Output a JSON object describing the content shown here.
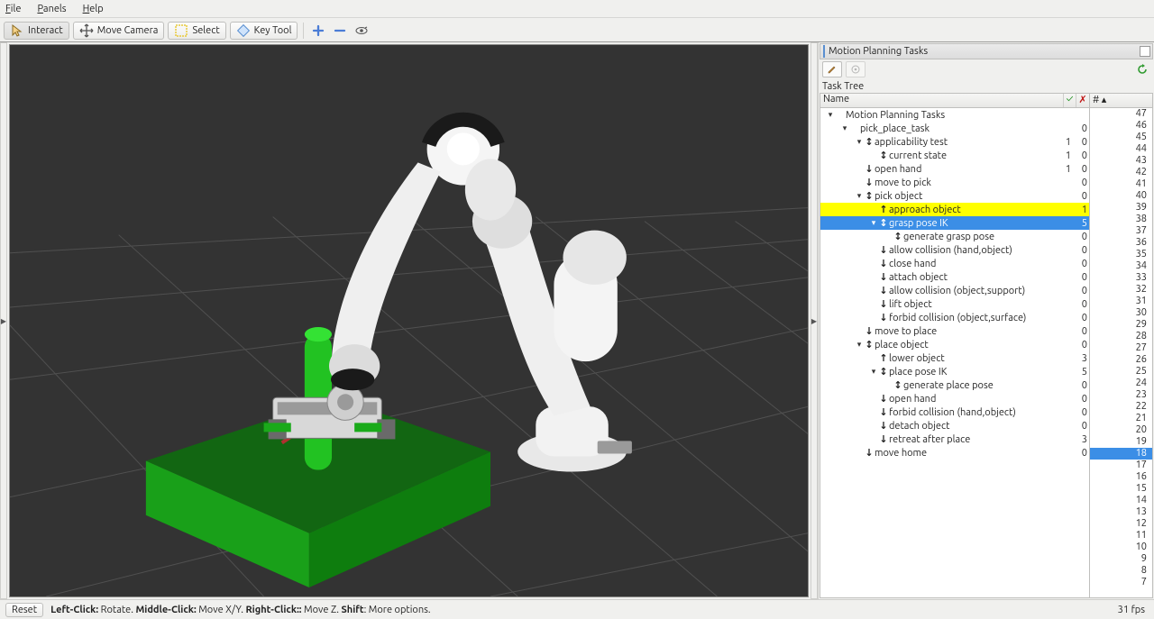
{
  "menu": {
    "file": "File",
    "panels": "Panels",
    "help": "Help"
  },
  "toolbar": {
    "interact": "Interact",
    "move_camera": "Move Camera",
    "select": "Select",
    "key_tool": "Key Tool"
  },
  "panel": {
    "title": "Motion Planning Tasks",
    "tree_label": "Task Tree",
    "head_name": "Name",
    "head_ok": "✓",
    "head_err": "✗",
    "head_count": "# ▴"
  },
  "tree": [
    {
      "depth": 0,
      "twisty": "▾",
      "arrow": "",
      "label": "Motion Planning Tasks",
      "v1": "",
      "v2": ""
    },
    {
      "depth": 1,
      "twisty": "▾",
      "arrow": "",
      "label": "pick_place_task",
      "v1": "",
      "v2": "0"
    },
    {
      "depth": 2,
      "twisty": "▾",
      "arrow": "↕",
      "label": "applicability test",
      "v1": "1",
      "v2": "0"
    },
    {
      "depth": 3,
      "twisty": "",
      "arrow": "↕",
      "label": "current state",
      "v1": "1",
      "v2": "0"
    },
    {
      "depth": 2,
      "twisty": "",
      "arrow": "↓",
      "label": "open hand",
      "v1": "1",
      "v2": "0"
    },
    {
      "depth": 2,
      "twisty": "",
      "arrow": "↓",
      "label": "move to pick",
      "v1": "",
      "v2": "0"
    },
    {
      "depth": 2,
      "twisty": "▾",
      "arrow": "↕",
      "label": "pick object",
      "v1": "",
      "v2": "0"
    },
    {
      "depth": 3,
      "twisty": "",
      "arrow": "↑",
      "label": "approach object",
      "v1": "",
      "v2": "1",
      "hl": "yellow"
    },
    {
      "depth": 3,
      "twisty": "▾",
      "arrow": "↕",
      "label": "grasp pose IK",
      "v1": "",
      "v2": "5",
      "hl": "blue"
    },
    {
      "depth": 4,
      "twisty": "",
      "arrow": "↕",
      "label": "generate grasp pose",
      "v1": "",
      "v2": "0"
    },
    {
      "depth": 3,
      "twisty": "",
      "arrow": "↓",
      "label": "allow collision (hand,object)",
      "v1": "",
      "v2": "0"
    },
    {
      "depth": 3,
      "twisty": "",
      "arrow": "↓",
      "label": "close hand",
      "v1": "",
      "v2": "0"
    },
    {
      "depth": 3,
      "twisty": "",
      "arrow": "↓",
      "label": "attach object",
      "v1": "",
      "v2": "0"
    },
    {
      "depth": 3,
      "twisty": "",
      "arrow": "↓",
      "label": "allow collision (object,support)",
      "v1": "",
      "v2": "0"
    },
    {
      "depth": 3,
      "twisty": "",
      "arrow": "↓",
      "label": "lift object",
      "v1": "",
      "v2": "0"
    },
    {
      "depth": 3,
      "twisty": "",
      "arrow": "↓",
      "label": "forbid collision (object,surface)",
      "v1": "",
      "v2": "0"
    },
    {
      "depth": 2,
      "twisty": "",
      "arrow": "↓",
      "label": "move to place",
      "v1": "",
      "v2": "0"
    },
    {
      "depth": 2,
      "twisty": "▾",
      "arrow": "↕",
      "label": "place object",
      "v1": "",
      "v2": "0"
    },
    {
      "depth": 3,
      "twisty": "",
      "arrow": "↑",
      "label": "lower object",
      "v1": "",
      "v2": "3"
    },
    {
      "depth": 3,
      "twisty": "▾",
      "arrow": "↕",
      "label": "place pose IK",
      "v1": "",
      "v2": "5"
    },
    {
      "depth": 4,
      "twisty": "",
      "arrow": "↕",
      "label": "generate place pose",
      "v1": "",
      "v2": "0"
    },
    {
      "depth": 3,
      "twisty": "",
      "arrow": "↓",
      "label": "open hand",
      "v1": "",
      "v2": "0"
    },
    {
      "depth": 3,
      "twisty": "",
      "arrow": "↓",
      "label": "forbid collision (hand,object)",
      "v1": "",
      "v2": "0"
    },
    {
      "depth": 3,
      "twisty": "",
      "arrow": "↓",
      "label": "detach object",
      "v1": "",
      "v2": "0"
    },
    {
      "depth": 3,
      "twisty": "",
      "arrow": "↓",
      "label": "retreat after place",
      "v1": "",
      "v2": "3"
    },
    {
      "depth": 2,
      "twisty": "",
      "arrow": "↓",
      "label": "move home",
      "v1": "",
      "v2": "0"
    }
  ],
  "solution_counts": [
    47,
    46,
    45,
    44,
    43,
    42,
    41,
    40,
    39,
    38,
    37,
    36,
    35,
    34,
    33,
    32,
    31,
    30,
    29,
    28,
    27,
    26,
    25,
    24,
    23,
    22,
    21,
    20,
    19,
    18,
    17,
    16,
    15,
    14,
    13,
    12,
    11,
    10,
    9,
    8,
    7
  ],
  "solution_selected": 18,
  "status": {
    "reset": "Reset",
    "hint_left": "Left-Click:",
    "hint_left_v": " Rotate. ",
    "hint_mid": "Middle-Click:",
    "hint_mid_v": " Move X/Y. ",
    "hint_right": "Right-Click::",
    "hint_right_v": " Move Z. ",
    "hint_shift": "Shift",
    "hint_shift_v": ": More options.",
    "fps": "31 fps"
  }
}
